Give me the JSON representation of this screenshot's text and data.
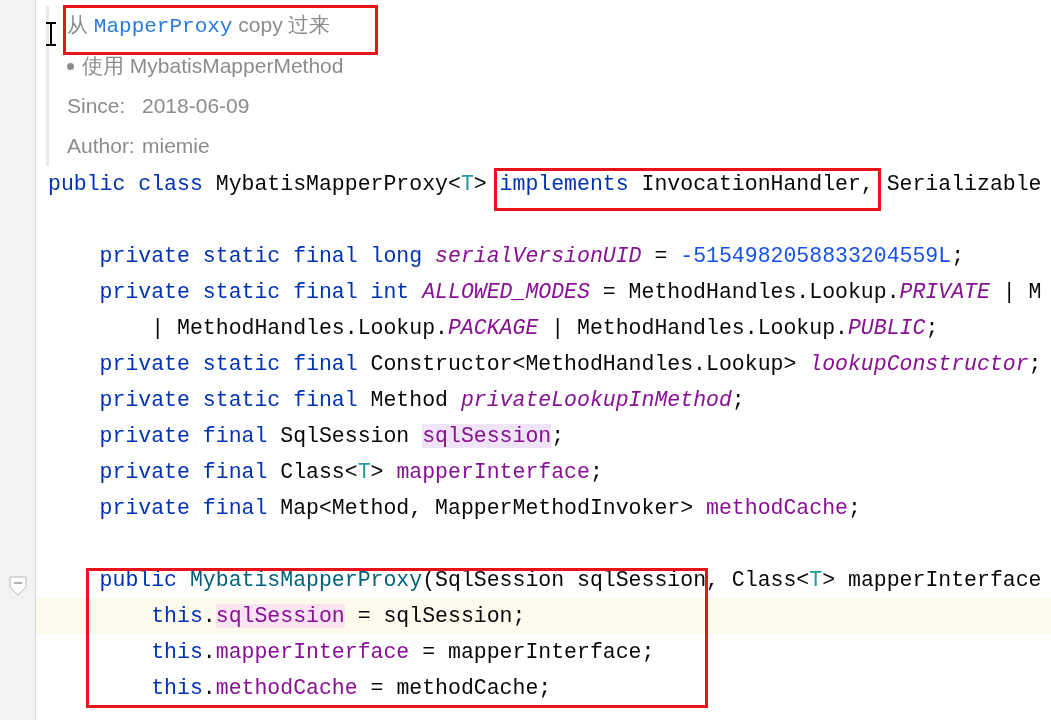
{
  "doc": {
    "lines": [
      {
        "kind": "text",
        "parts": [
          {
            "t": "从 ",
            "kind": "plain"
          },
          {
            "t": "MapperProxy",
            "kind": "code"
          },
          {
            "t": " copy 过来",
            "kind": "plain"
          }
        ]
      },
      {
        "kind": "bullet",
        "parts": [
          {
            "t": "使用 MybatisMapperMethod",
            "kind": "plain"
          }
        ]
      },
      {
        "kind": "tag",
        "label": "Since:",
        "value": "2018-06-09"
      },
      {
        "kind": "tag",
        "label": "Author:",
        "value": "miemie"
      }
    ]
  },
  "code": [
    {
      "kind": "code",
      "current": false,
      "fold": false,
      "tokens": [
        {
          "t": "public class ",
          "kind": "kw"
        },
        {
          "t": "MybatisMapperProxy<",
          "kind": "plain"
        },
        {
          "t": "T",
          "kind": "tparam"
        },
        {
          "t": "> ",
          "kind": "plain"
        },
        {
          "t": "implements",
          "kind": "kw"
        },
        {
          "t": " InvocationHandler, Serializable",
          "kind": "plain"
        }
      ]
    },
    {
      "kind": "blank"
    },
    {
      "kind": "code",
      "current": false,
      "fold": false,
      "tokens": [
        {
          "t": "    private static final long ",
          "kind": "kw"
        },
        {
          "t": "serialVersionUID",
          "kind": "static"
        },
        {
          "t": " = ",
          "kind": "plain"
        },
        {
          "t": "-5154982058833204559L",
          "kind": "num"
        },
        {
          "t": ";",
          "kind": "plain"
        }
      ]
    },
    {
      "kind": "code",
      "current": false,
      "fold": false,
      "tokens": [
        {
          "t": "    private static final int ",
          "kind": "kw"
        },
        {
          "t": "ALLOWED_MODES",
          "kind": "static"
        },
        {
          "t": " = MethodHandles.Lookup.",
          "kind": "plain"
        },
        {
          "t": "PRIVATE",
          "kind": "static"
        },
        {
          "t": " | M",
          "kind": "plain"
        }
      ]
    },
    {
      "kind": "code",
      "current": false,
      "fold": false,
      "tokens": [
        {
          "t": "        | MethodHandles.Lookup.",
          "kind": "plain"
        },
        {
          "t": "PACKAGE",
          "kind": "static"
        },
        {
          "t": " | MethodHandles.Lookup.",
          "kind": "plain"
        },
        {
          "t": "PUBLIC",
          "kind": "static"
        },
        {
          "t": ";",
          "kind": "plain"
        }
      ]
    },
    {
      "kind": "code",
      "current": false,
      "fold": false,
      "tokens": [
        {
          "t": "    private static final ",
          "kind": "kw"
        },
        {
          "t": "Constructor<MethodHandles.Lookup> ",
          "kind": "plain"
        },
        {
          "t": "lookupConstructor",
          "kind": "static"
        },
        {
          "t": ";",
          "kind": "plain"
        }
      ]
    },
    {
      "kind": "code",
      "current": false,
      "fold": false,
      "tokens": [
        {
          "t": "    private static final ",
          "kind": "kw"
        },
        {
          "t": "Method ",
          "kind": "plain"
        },
        {
          "t": "privateLookupInMethod",
          "kind": "static"
        },
        {
          "t": ";",
          "kind": "plain"
        }
      ]
    },
    {
      "kind": "code",
      "current": false,
      "fold": false,
      "tokens": [
        {
          "t": "    private final ",
          "kind": "kw"
        },
        {
          "t": "SqlSession ",
          "kind": "plain"
        },
        {
          "t": "sqlSession",
          "kind": "field",
          "color": "#f0e4f8"
        },
        {
          "t": ";",
          "kind": "plain"
        }
      ]
    },
    {
      "kind": "code",
      "current": false,
      "fold": false,
      "tokens": [
        {
          "t": "    private final ",
          "kind": "kw"
        },
        {
          "t": "Class<",
          "kind": "plain"
        },
        {
          "t": "T",
          "kind": "tparam"
        },
        {
          "t": "> ",
          "kind": "plain"
        },
        {
          "t": "mapperInterface",
          "kind": "field"
        },
        {
          "t": ";",
          "kind": "plain"
        }
      ]
    },
    {
      "kind": "code",
      "current": false,
      "fold": false,
      "tokens": [
        {
          "t": "    private final ",
          "kind": "kw"
        },
        {
          "t": "Map<Method, MapperMethodInvoker> ",
          "kind": "plain"
        },
        {
          "t": "methodCache",
          "kind": "field"
        },
        {
          "t": ";",
          "kind": "plain"
        }
      ]
    },
    {
      "kind": "blank"
    },
    {
      "kind": "code",
      "current": false,
      "fold": true,
      "tokens": [
        {
          "t": "    public ",
          "kind": "kw"
        },
        {
          "t": "MybatisMapperProxy",
          "kind": "decl"
        },
        {
          "t": "(SqlSession sqlSession, Class<",
          "kind": "plain"
        },
        {
          "t": "T",
          "kind": "tparam"
        },
        {
          "t": "> mapperInterface",
          "kind": "plain"
        }
      ]
    },
    {
      "kind": "code",
      "current": true,
      "fold": false,
      "tokens": [
        {
          "t": "        this",
          "kind": "kw"
        },
        {
          "t": ".",
          "kind": "plain"
        },
        {
          "t": "sqlSession",
          "kind": "field",
          "color": "#fae3f2"
        },
        {
          "t": " = sqlSession;",
          "kind": "plain"
        }
      ]
    },
    {
      "kind": "code",
      "current": false,
      "fold": false,
      "tokens": [
        {
          "t": "        this",
          "kind": "kw"
        },
        {
          "t": ".",
          "kind": "plain"
        },
        {
          "t": "mapperInterface",
          "kind": "field"
        },
        {
          "t": " = mapperInterface;",
          "kind": "plain"
        }
      ]
    },
    {
      "kind": "code",
      "current": false,
      "fold": false,
      "tokens": [
        {
          "t": "        this",
          "kind": "kw"
        },
        {
          "t": ".",
          "kind": "plain"
        },
        {
          "t": "methodCache",
          "kind": "field"
        },
        {
          "t": " = methodCache;",
          "kind": "plain"
        }
      ]
    }
  ]
}
